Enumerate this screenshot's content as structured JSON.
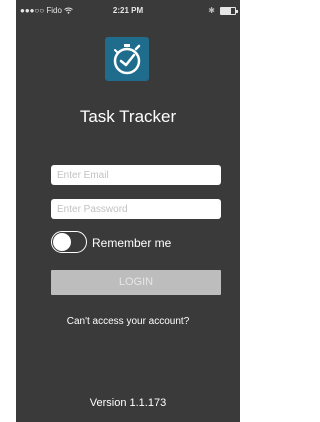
{
  "status_bar": {
    "carrier": "●●●○○ Fido",
    "time": "2:21 PM"
  },
  "app": {
    "logo_icon": "stopwatch-check-icon",
    "title": "Task Tracker"
  },
  "form": {
    "email_placeholder": "Enter Email",
    "password_placeholder": "Enter Password",
    "remember_label": "Remember me",
    "remember_checked": false,
    "login_label": "LOGIN"
  },
  "links": {
    "cant_access": "Can't access your account?"
  },
  "footer": {
    "version": "Version 1.1.173"
  },
  "colors": {
    "background": "#3a3a3a",
    "logo_bg": "#1f6c8c",
    "login_button": "#bdbdbd"
  }
}
